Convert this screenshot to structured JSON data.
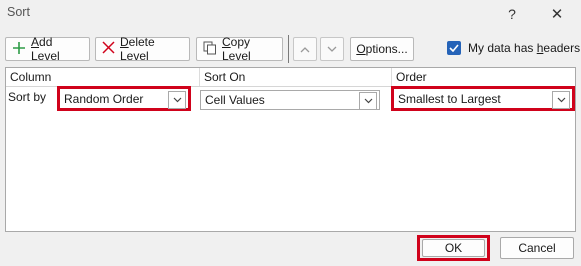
{
  "dialog": {
    "title": "Sort",
    "help_label": "?",
    "close_label": "✕"
  },
  "toolbar": {
    "add_level": {
      "accel": "A",
      "rest": "dd Level"
    },
    "delete_level": {
      "accel": "D",
      "rest": "elete Level"
    },
    "copy_level": {
      "accel": "C",
      "rest": "opy Level"
    },
    "options": {
      "accel": "O",
      "rest": "ptions..."
    },
    "my_data_has_headers": {
      "pre": "My data has ",
      "accel": "h",
      "post": "eaders",
      "checked": true
    }
  },
  "grid": {
    "headers": {
      "column": "Column",
      "sort_on": "Sort On",
      "order": "Order"
    },
    "rows": [
      {
        "label": "Sort by",
        "column_value": "Random Order",
        "sort_on_value": "Cell Values",
        "order_value": "Smallest to Largest"
      }
    ]
  },
  "footer": {
    "ok_label": "OK",
    "cancel_label": "Cancel"
  },
  "colors": {
    "highlight": "#d0021b",
    "checkbox": "#2563b8",
    "add_icon": "#2e9c47",
    "delete_icon": "#d0021b"
  }
}
